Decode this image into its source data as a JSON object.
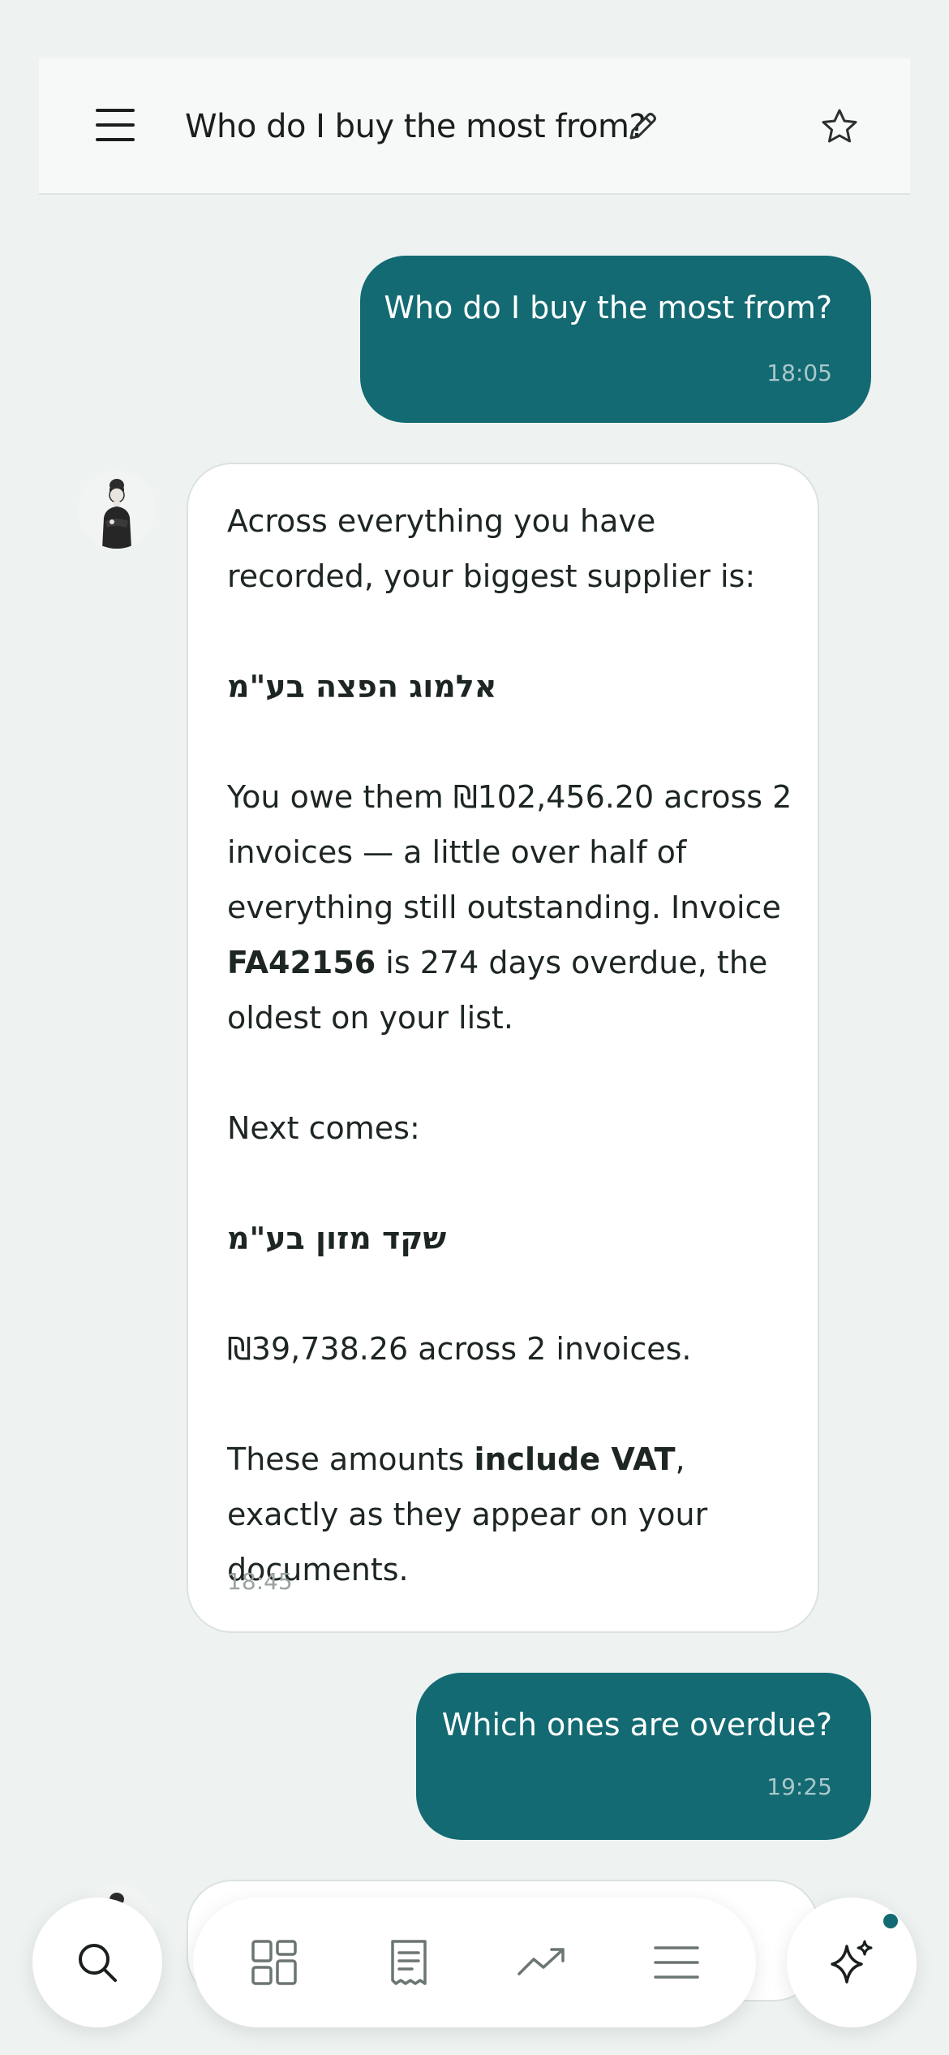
{
  "header": {
    "title": "Who do I buy the most from?",
    "icons": [
      "menu-icon",
      "pencil-icon",
      "star-icon"
    ]
  },
  "messages": [
    {
      "role": "user",
      "text": "Who do I buy the most from?",
      "time": "18:05"
    },
    {
      "role": "assistant",
      "intro": "Across everything you have recorded, your biggest supplier is:",
      "supplier1": "אלמוג הפצה בע\"מ",
      "owe_prefix": "You owe them ₪102,456.20 across 2 invoices — a little over half of everything still outstanding. Invoice ",
      "invoice_id": "FA42156",
      "owe_suffix": " is 274 days overdue, the oldest on your list.",
      "next": "Next comes:",
      "supplier2": "שקד מזון בע\"מ",
      "amount2": "₪39,738.26 across 2 invoices.",
      "vat_prefix": "These amounts ",
      "vat_bold": "include VAT",
      "vat_suffix": ", exactly as they appear on your documents.",
      "time": "18:45"
    },
    {
      "role": "user",
      "text": "Which ones are overdue?",
      "time": "19:25"
    }
  ],
  "bottom_nav": {
    "items": [
      "search-icon",
      "dashboard-icon",
      "receipt-icon",
      "trending-icon",
      "list-icon",
      "sparkles-icon"
    ],
    "accent": "#136a72"
  },
  "colors": {
    "background": "#eef3f1",
    "user_bubble": "#136a72",
    "bot_bubble": "#ffffff"
  }
}
